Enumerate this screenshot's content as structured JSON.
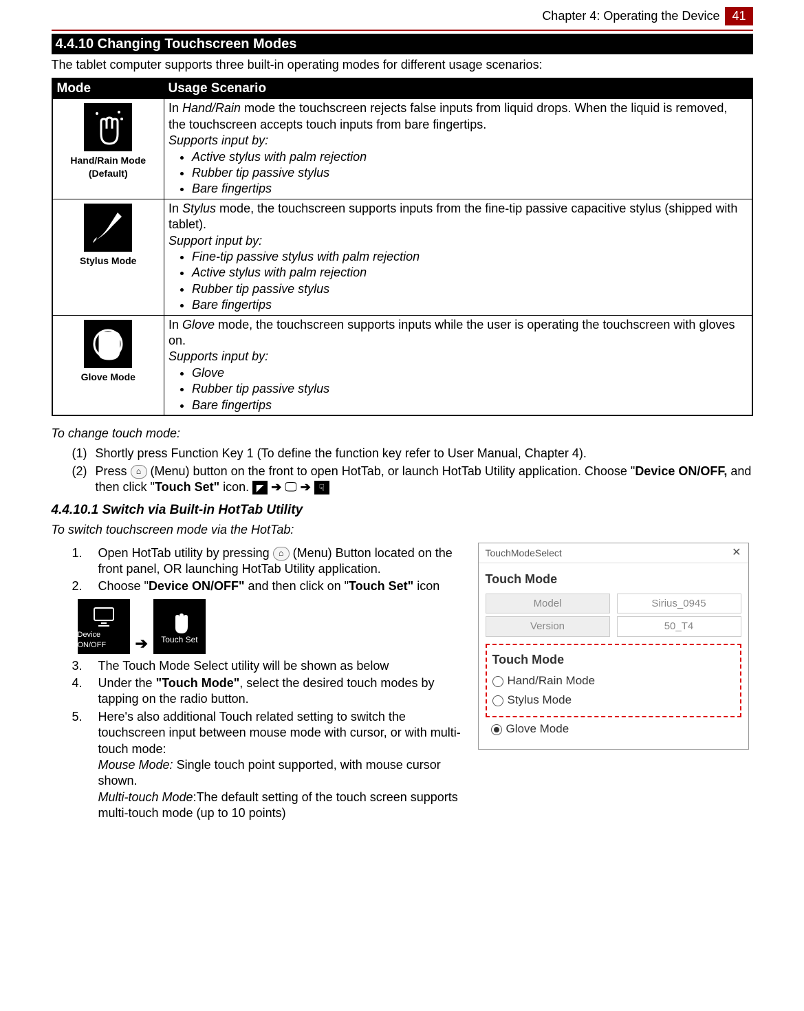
{
  "header": {
    "chapter": "Chapter 4: Operating the Device",
    "page": "41"
  },
  "section": {
    "heading": "4.4.10 Changing Touchscreen Modes",
    "intro": "The tablet computer supports three built-in operating modes for different usage scenarios:"
  },
  "table": {
    "col1": "Mode",
    "col2": "Usage Scenario",
    "rows": [
      {
        "label": "Hand/Rain Mode (Default)",
        "intro_pre": "In ",
        "intro_em": "Hand/Rain",
        "intro_post": " mode the touchscreen rejects false inputs from liquid drops. When the liquid is removed, the touchscreen accepts touch inputs from bare fingertips.",
        "supports": "Supports input by:",
        "bullets": [
          "Active stylus with palm rejection",
          "Rubber tip passive stylus",
          "Bare fingertips"
        ]
      },
      {
        "label": "Stylus Mode",
        "intro_pre": "In ",
        "intro_em": "Stylus",
        "intro_post": " mode, the touchscreen supports inputs from the fine-tip passive capacitive stylus (shipped with tablet).",
        "supports": "Support input by:",
        "bullets": [
          "Fine-tip passive stylus with palm rejection",
          "Active stylus with palm rejection",
          "Rubber tip passive stylus",
          "Bare fingertips"
        ]
      },
      {
        "label": "Glove Mode",
        "intro_pre": "In ",
        "intro_em": "Glove",
        "intro_post": " mode, the touchscreen supports inputs while the user is operating the touchscreen with gloves on.",
        "supports": "Supports input by:",
        "bullets": [
          "Glove",
          "Rubber tip passive stylus",
          "Bare fingertips"
        ]
      }
    ]
  },
  "change": {
    "heading": "To change touch mode:",
    "step1_num": "(1)",
    "step1": "Shortly press Function Key 1 (To define the function key refer to User Manual, Chapter 4).",
    "step2_num": "(2)",
    "step2_pre": "Press ",
    "step2_mid": " (Menu) button on the front to open HotTab, or launch HotTab Utility application. Choose \"",
    "step2_bold1": "Device ON/OFF,",
    "step2_mid2": " and then click \"",
    "step2_bold2": "Touch Set\"",
    "step2_post": " icon. "
  },
  "subsection": {
    "heading": "4.4.10.1 Switch via Built-in HotTab Utility",
    "intro": "To switch touchscreen mode via the HotTab:"
  },
  "steps": {
    "s1_num": "1.",
    "s1_pre": "Open HotTab utility by pressing ",
    "s1_post": " (Menu) Button located on the front panel, OR launching HotTab Utility application.",
    "s2_num": "2.",
    "s2_pre": "Choose \"",
    "s2_b1": "Device ON/OFF\"",
    "s2_mid": " and then click on \"",
    "s2_b2": "Touch Set\"",
    "s2_post": " icon",
    "icon_device_label": "Device ON/OFF",
    "icon_touch_label": "Touch Set",
    "s3_num": "3.",
    "s3": "The Touch Mode Select utility will be shown as below",
    "s4_num": "4.",
    "s4_pre": "Under the ",
    "s4_b": "\"Touch Mode\"",
    "s4_post": ", select the desired touch modes by tapping on the radio button.",
    "s5_num": "5.",
    "s5_main": "Here's also additional Touch related setting to switch the touchscreen input between mouse mode with cursor, or with multi-touch mode:",
    "s5_mouse_em": "Mouse Mode:",
    "s5_mouse": " Single touch point supported, with mouse cursor shown.",
    "s5_multi_em": "Multi-touch Mode",
    "s5_multi": ":The default setting of the touch screen supports multi-touch mode (up to 10 points)"
  },
  "window": {
    "title": "TouchModeSelect",
    "h1": "Touch Mode",
    "model_label": "Model",
    "model_value": "Sirius_0945",
    "version_label": "Version",
    "version_value": "50_T4",
    "h2": "Touch Mode",
    "opt1": "Hand/Rain Mode",
    "opt2": "Stylus Mode",
    "opt3": "Glove Mode"
  }
}
